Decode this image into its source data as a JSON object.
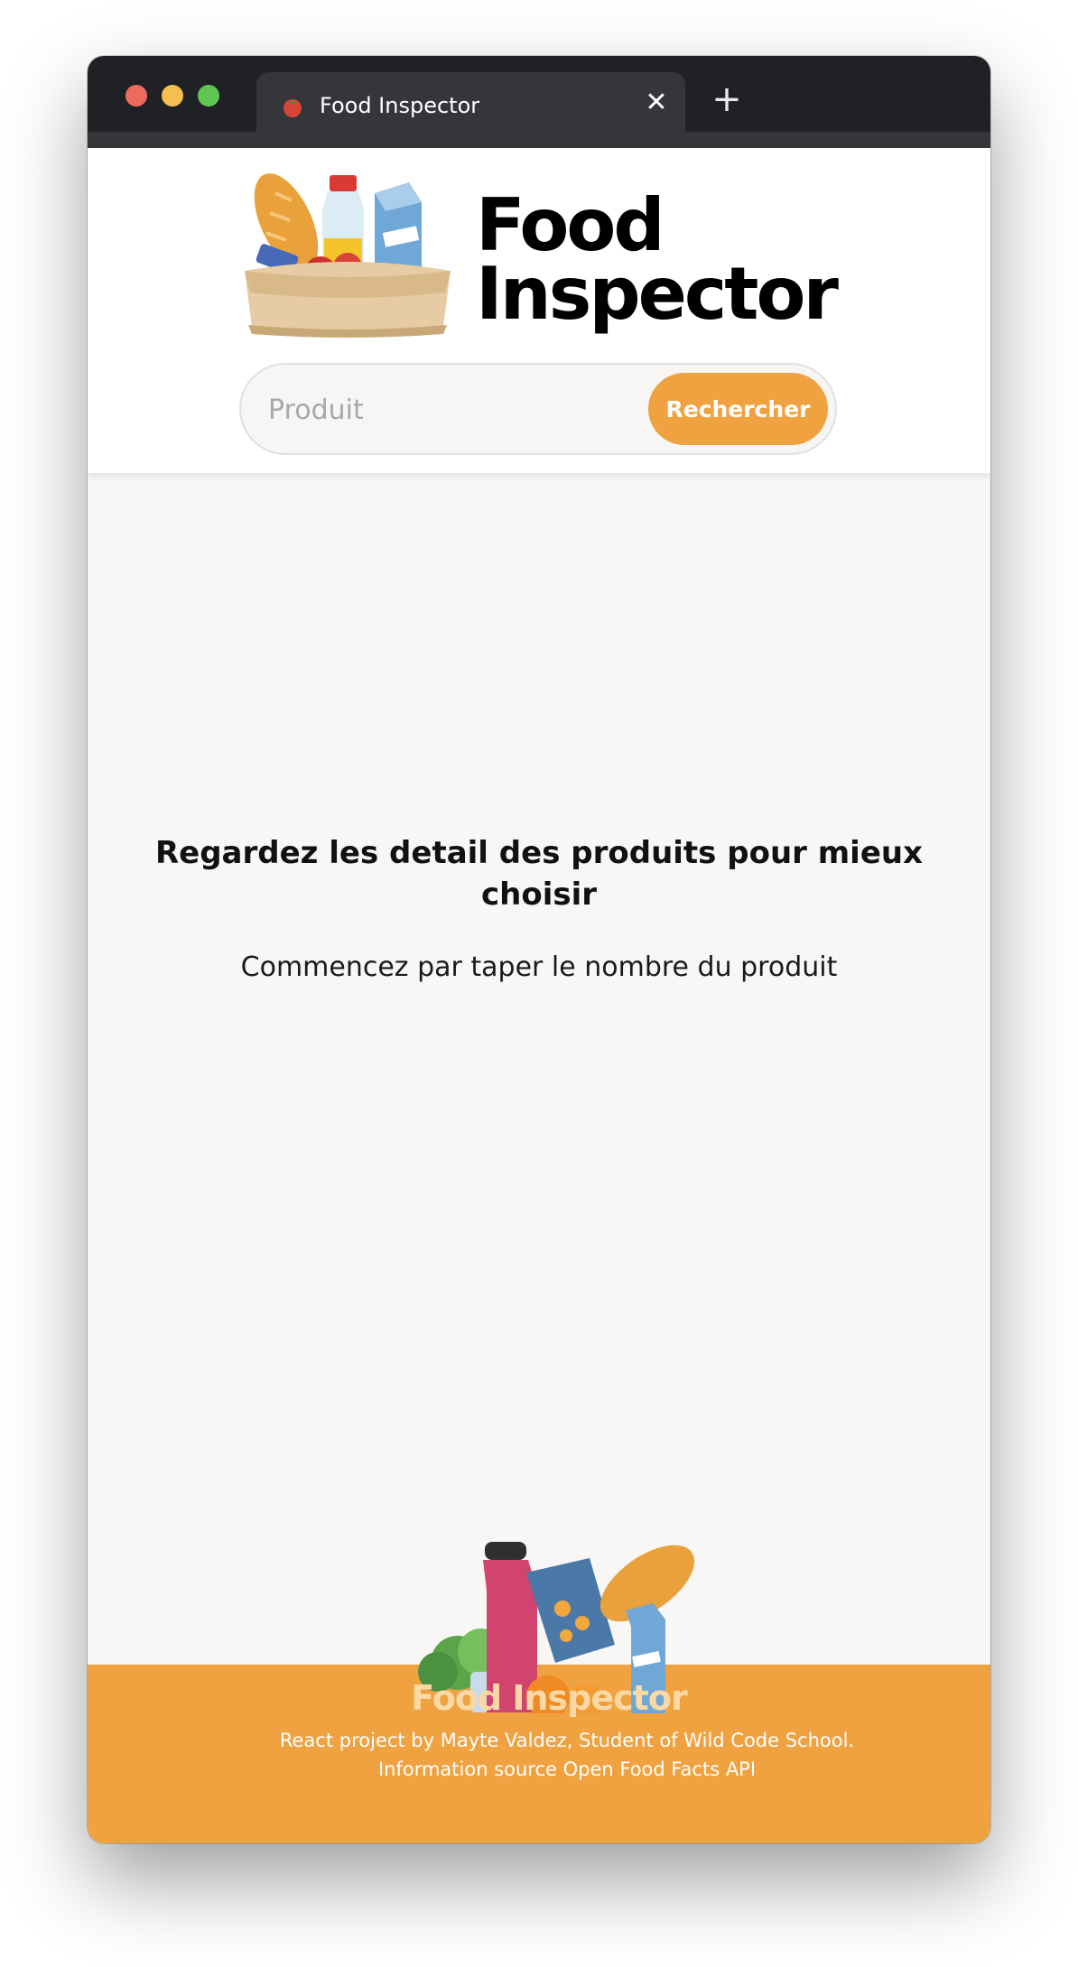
{
  "browser": {
    "tab_title": "Food Inspector",
    "tab_favicon": "tomato-icon",
    "close_glyph": "✕",
    "new_tab_glyph": "+"
  },
  "header": {
    "logo_line1": "Food",
    "logo_line2": "Inspector",
    "logo_image": "grocery-bag-illustration",
    "search": {
      "placeholder": "Produit",
      "value": "",
      "button_label": "Rechercher"
    }
  },
  "main": {
    "heading": "Regardez les detail des produits pour mieux choisir",
    "subheading": "Commencez par taper le nombre du produit"
  },
  "footer": {
    "image": "groceries-illustration",
    "title": "Food Inspector",
    "credit_line1": "React project by Mayte Valdez, Student of Wild Code School.",
    "credit_line2": "Information source Open Food Facts API"
  },
  "colors": {
    "accent": "#f0a241",
    "titlebar": "#202124",
    "tab": "#34363a",
    "page_bg": "#f8f7f6"
  }
}
